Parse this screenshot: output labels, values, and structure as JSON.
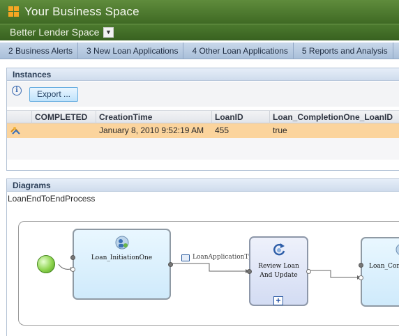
{
  "header": {
    "title": "Your Business Space"
  },
  "space": {
    "name": "Better Lender Space"
  },
  "page_tabs": [
    {
      "label": "2 Business Alerts"
    },
    {
      "label": "3 New Loan Applications"
    },
    {
      "label": "4 Other Loan Applications"
    },
    {
      "label": "5 Reports and Analysis"
    }
  ],
  "instances": {
    "title": "Instances",
    "export_label": "Export ...",
    "columns": [
      "COMPLETED",
      "CreationTime",
      "LoanID",
      "Loan_CompletionOne_LoanID"
    ],
    "rows": [
      {
        "completed": "",
        "creation_time": "January 8, 2010 9:52:19 AM",
        "loan_id": "455",
        "completion_loan_id": "true"
      }
    ]
  },
  "diagrams": {
    "title": "Diagrams",
    "process_name": "LoanEndToEndProcess",
    "nodes": {
      "initiation": "Loan_InitiationOne",
      "review_line1": "Review Loan",
      "review_line2": "And Update",
      "completion": "Loan_Com"
    },
    "edge_label": "LoanApplicationType"
  },
  "colors": {
    "header_green": "#4c7a2e",
    "tab_blue": "#c9d8ea",
    "selected_row": "#fbd49d",
    "node_fill_light": "#d6eefb",
    "node_fill_review": "#dce3f6"
  }
}
